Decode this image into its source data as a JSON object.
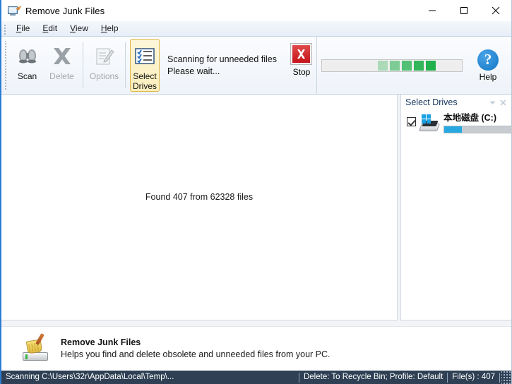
{
  "window": {
    "title": "Remove Junk Files",
    "icon": "monitor-pencil-icon",
    "minimize": "minimize-button",
    "maximize": "maximize-button",
    "close": "close-button"
  },
  "menu": {
    "items": [
      {
        "accel": "F",
        "rest": "ile"
      },
      {
        "accel": "E",
        "rest": "dit"
      },
      {
        "accel": "V",
        "rest": "iew"
      },
      {
        "accel": "H",
        "rest": "elp"
      }
    ]
  },
  "toolbar": {
    "buttons": [
      {
        "label": "Scan",
        "icon": "binoculars-icon",
        "enabled": true,
        "selected": false
      },
      {
        "label": "Delete",
        "icon": "x-cross-icon",
        "enabled": false,
        "selected": false
      },
      {
        "label": "Options",
        "icon": "document-pencil-icon",
        "enabled": false,
        "selected": false
      },
      {
        "label": "Select\nDrives",
        "label_line1": "Select",
        "label_line2": "Drives",
        "icon": "checklist-icon",
        "enabled": true,
        "selected": true
      }
    ],
    "status_line1": "Scanning for unneeded files",
    "status_line2": "Please wait...",
    "stop_label": "Stop",
    "stop_icon": "red-x-icon",
    "help_label": "Help",
    "help_icon": "question-mark-icon",
    "progress": {
      "type": "marquee",
      "blocks": 5,
      "color": "#22b14c"
    }
  },
  "main": {
    "found_text": "Found 407 from 62328 files"
  },
  "drives_panel": {
    "title": "Select Drives",
    "auto_hide_icon": "chevron-down-icon",
    "close_icon": "close-icon",
    "drives": [
      {
        "name": "本地磁盘 (C:)",
        "checked": true,
        "icon": "windows-drive-icon",
        "usage_percent": 25,
        "usage_color": "#28a8e0"
      }
    ]
  },
  "info": {
    "icon": "broom-drive-icon",
    "title": "Remove Junk Files",
    "description": "Helps you find and delete obsolete and unneeded files from your PC."
  },
  "statusbar": {
    "scanning": "Scanning C:\\Users\\32r\\AppData\\Local\\Temp\\...",
    "profile": "Delete: To Recycle Bin; Profile: Default",
    "files": "File(s) : 407",
    "grip": "resize-grip"
  }
}
